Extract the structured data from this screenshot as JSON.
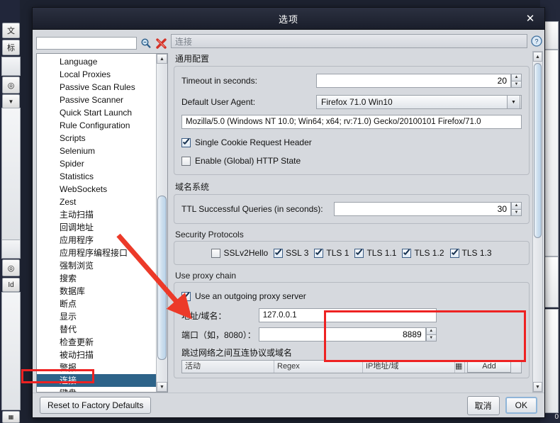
{
  "window": {
    "title": "选项",
    "close_label": "✕"
  },
  "search": {
    "value": "",
    "placeholder": "",
    "search_icon": "magnifier-icon",
    "clear_icon": "red-x-icon"
  },
  "tree": {
    "items": [
      {
        "label": "Language",
        "selected": false
      },
      {
        "label": "Local Proxies",
        "selected": false
      },
      {
        "label": "Passive Scan Rules",
        "selected": false
      },
      {
        "label": "Passive Scanner",
        "selected": false
      },
      {
        "label": "Quick Start Launch",
        "selected": false
      },
      {
        "label": "Rule Configuration",
        "selected": false
      },
      {
        "label": "Scripts",
        "selected": false
      },
      {
        "label": "Selenium",
        "selected": false
      },
      {
        "label": "Spider",
        "selected": false
      },
      {
        "label": "Statistics",
        "selected": false
      },
      {
        "label": "WebSockets",
        "selected": false
      },
      {
        "label": "Zest",
        "selected": false
      },
      {
        "label": "主动扫描",
        "selected": false
      },
      {
        "label": "回调地址",
        "selected": false
      },
      {
        "label": "应用程序",
        "selected": false
      },
      {
        "label": "应用程序编程接口",
        "selected": false
      },
      {
        "label": "强制浏览",
        "selected": false
      },
      {
        "label": "搜索",
        "selected": false
      },
      {
        "label": "数据库",
        "selected": false
      },
      {
        "label": "断点",
        "selected": false
      },
      {
        "label": "显示",
        "selected": false
      },
      {
        "label": "替代",
        "selected": false
      },
      {
        "label": "检查更新",
        "selected": false
      },
      {
        "label": "被动扫描",
        "selected": false
      },
      {
        "label": "警报",
        "selected": false
      },
      {
        "label": "连接",
        "selected": true
      },
      {
        "label": "键盘",
        "selected": false
      }
    ]
  },
  "breadcrumb": {
    "text": "连接",
    "help_icon": "help-circle-icon"
  },
  "general": {
    "title": "通用配置",
    "timeout_label": "Timeout in seconds:",
    "timeout_value": "20",
    "user_agent_label": "Default User Agent:",
    "user_agent_value": "Firefox 71.0 Win10",
    "user_agent_string": "Mozilla/5.0 (Windows NT 10.0; Win64; x64; rv:71.0) Gecko/20100101 Firefox/71.0",
    "single_cookie_label": "Single Cookie Request Header",
    "single_cookie_checked": true,
    "http_state_label": "Enable (Global) HTTP State",
    "http_state_checked": false
  },
  "dns": {
    "title": "域名系统",
    "ttl_label": "TTL Successful Queries (in seconds):",
    "ttl_value": "30"
  },
  "security": {
    "title": "Security Protocols",
    "protocols": [
      {
        "label": "SSLv2Hello",
        "checked": false
      },
      {
        "label": "SSL 3",
        "checked": true
      },
      {
        "label": "TLS 1",
        "checked": true
      },
      {
        "label": "TLS 1.1",
        "checked": true
      },
      {
        "label": "TLS 1.2",
        "checked": true
      },
      {
        "label": "TLS 1.3",
        "checked": true
      }
    ]
  },
  "proxy": {
    "title": "Use proxy chain",
    "use_outgoing_label": "Use an outgoing proxy server",
    "use_outgoing_checked": true,
    "address_label": "地址/域名：",
    "address_value": "127.0.0.1",
    "port_label": "端口（如，8080）：",
    "port_value": "8889",
    "skip_label": "跳过网络之间互连协议或域名",
    "table_headers": [
      "活动",
      "Regex",
      "IP地址/域"
    ],
    "add_button": "Add"
  },
  "footer": {
    "reset_label": "Reset to Factory Defaults",
    "cancel_label": "取消",
    "ok_label": "OK"
  },
  "background": {
    "left_icons": [
      "文",
      "标"
    ],
    "id_label": "Id",
    "corner_number": "0"
  },
  "annotations": {
    "highlight_color": "#ee2222",
    "arrow_color": "#ec3a29"
  }
}
